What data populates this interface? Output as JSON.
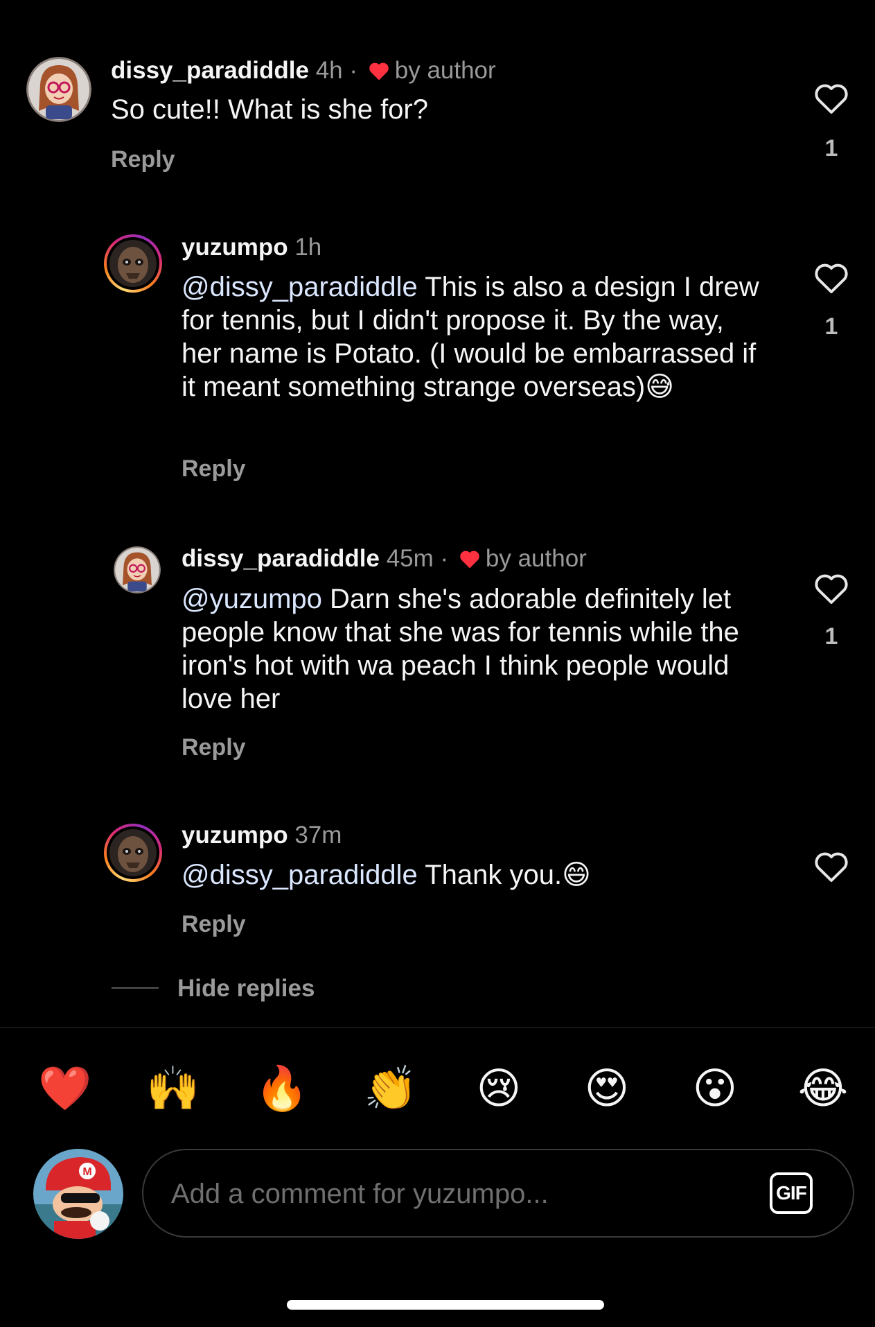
{
  "comments": [
    {
      "username": "dissy_paradiddle",
      "time": "4h",
      "dot": "·",
      "liked_by_author": "by author",
      "mention": "",
      "text": "So cute!! What is she for?",
      "reply_label": "Reply",
      "like_count": "1"
    },
    {
      "username": "yuzumpo",
      "time": "1h",
      "mention": "@dissy_paradiddle",
      "text": " This is also a design I drew for tennis, but I didn't propose it. By the way, her name is Potato. (I would be embarrassed if it meant something strange overseas)😅",
      "reply_label": "Reply",
      "like_count": "1"
    },
    {
      "username": "dissy_paradiddle",
      "time": "45m",
      "dot": "·",
      "liked_by_author": "by author",
      "mention": "@yuzumpo",
      "text": " Darn she's adorable definitely let people know that she was for tennis while the iron's hot with wa peach I think people would love her",
      "reply_label": "Reply",
      "like_count": "1"
    },
    {
      "username": "yuzumpo",
      "time": "37m",
      "mention": "@dissy_paradiddle",
      "text": " Thank you.😄",
      "reply_label": "Reply",
      "like_count": ""
    }
  ],
  "hide_replies": "Hide replies",
  "quick_reactions": [
    "❤️",
    "🙌",
    "🔥",
    "👏",
    "😢",
    "😍",
    "😮",
    "😂"
  ],
  "composer": {
    "placeholder": "Add a comment for yuzumpo...",
    "gif_label": "GIF"
  },
  "icons": {
    "like": "heart-outline-icon",
    "author_like": "heart-filled-icon"
  },
  "colors": {
    "background": "#000000",
    "author_heart": "#ff3040",
    "mention": "#dbe7ff",
    "muted": "#9a9a9a"
  }
}
